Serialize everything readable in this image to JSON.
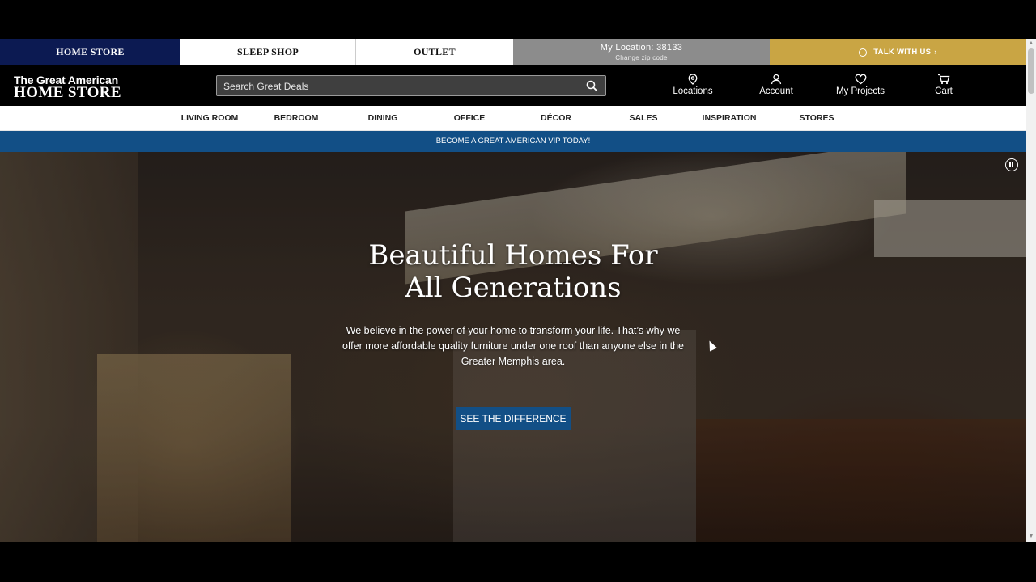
{
  "store_tabs": {
    "home": "HOME STORE",
    "sleep": "SLEEP SHOP",
    "outlet": "OUTLET",
    "location": "My Location: 38133",
    "change_zip": "Change zip code",
    "talk": "TALK WITH US"
  },
  "header": {
    "logo_line1": "The Great American",
    "logo_line2": "HOME STORE",
    "search_placeholder": "Search Great Deals",
    "locations": "Locations",
    "account": "Account",
    "projects": "My Projects",
    "cart": "Cart"
  },
  "nav": [
    "LIVING ROOM",
    "BEDROOM",
    "DINING",
    "OFFICE",
    "DÉCOR",
    "SALES",
    "INSPIRATION",
    "STORES"
  ],
  "promo": "BECOME A GREAT AMERICAN VIP TODAY!",
  "hero": {
    "title_line1": "Beautiful Homes For",
    "title_line2": "All Generations",
    "text": "We believe in the power of your home to transform your life. That’s why we offer more affordable quality furniture under one roof than anyone else in the Greater Memphis area.",
    "cta": "SEE THE DIFFERENCE"
  },
  "colors": {
    "home_tab": "#0c1a52",
    "talk_tab": "#c9a544",
    "location_tab": "#8c8c8c",
    "promo": "#124f86",
    "cta": "#124f86"
  }
}
